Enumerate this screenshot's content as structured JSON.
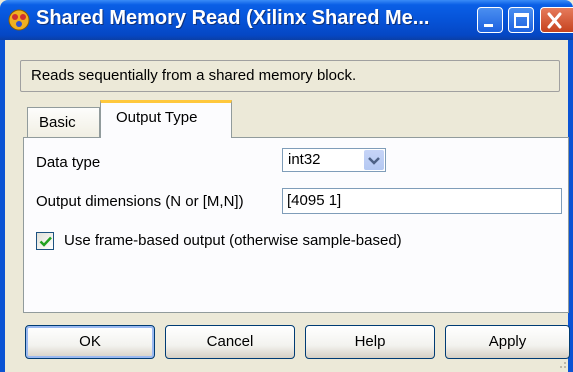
{
  "window": {
    "title": "Shared Memory Read (Xilinx Shared Me...",
    "app_icon": "simulink-block-icon",
    "title_bar_color": "#0a5fe6"
  },
  "description": "Reads sequentially from a shared memory block.",
  "tabs": [
    {
      "label": "Basic",
      "selected": false
    },
    {
      "label": "Output Type",
      "selected": true
    }
  ],
  "fields": {
    "data_type": {
      "label": "Data type",
      "value": "int32"
    },
    "output_dimensions": {
      "label": "Output dimensions (N or [M,N])",
      "value": "[4095 1]"
    },
    "frame_based": {
      "label": "Use frame-based output (otherwise sample-based)",
      "checked": true
    }
  },
  "buttons": {
    "ok": "OK",
    "cancel": "Cancel",
    "help": "Help",
    "apply": "Apply"
  },
  "colors": {
    "active_tab_accent": "#ffc83c",
    "checkmark": "#21a121"
  }
}
